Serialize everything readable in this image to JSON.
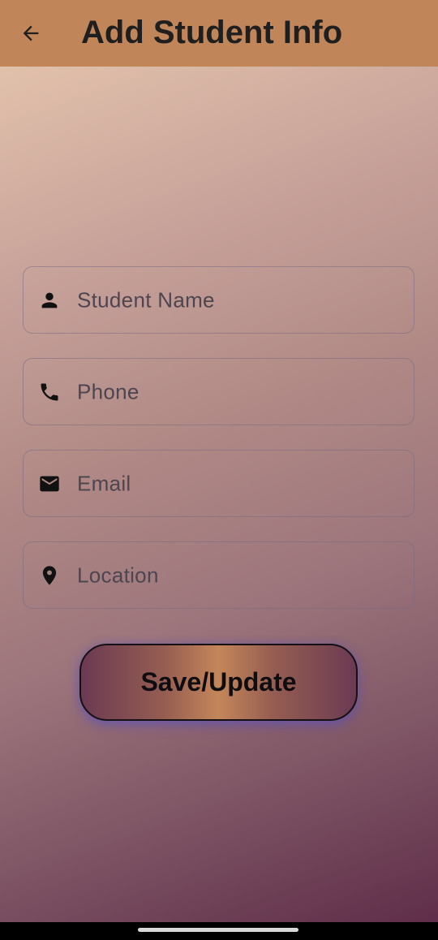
{
  "app_bar": {
    "title": "Add Student Info",
    "back_icon": "arrow-back-icon",
    "background": "#c0865a"
  },
  "form": {
    "fields": [
      {
        "name": "student-name",
        "placeholder": "Student Name",
        "icon": "person-icon"
      },
      {
        "name": "phone",
        "placeholder": "Phone",
        "icon": "phone-icon"
      },
      {
        "name": "email",
        "placeholder": "Email",
        "icon": "mail-icon"
      },
      {
        "name": "location",
        "placeholder": "Location",
        "icon": "location-pin-icon"
      }
    ],
    "submit_label": "Save/Update"
  },
  "colors": {
    "gradient_top": "#e2c1ab",
    "gradient_bottom": "#5f2d49",
    "button_accent": "#c4865a",
    "button_glow": "#5a50be"
  }
}
